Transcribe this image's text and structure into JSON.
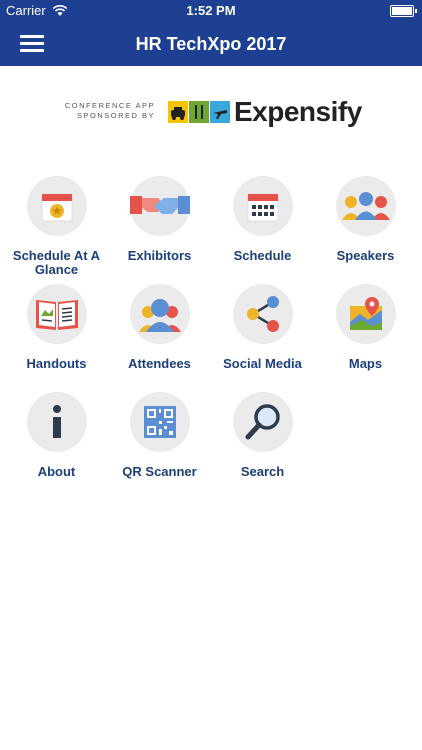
{
  "status_bar": {
    "carrier": "Carrier",
    "time": "1:52 PM",
    "battery_level": 1.0
  },
  "header": {
    "title": "HR TechXpo 2017",
    "menu_icon": "hamburger-menu-icon"
  },
  "sponsor": {
    "line1": "CONFERENCE APP",
    "line2": "SPONSORED BY",
    "brand": "Expensify"
  },
  "tiles": [
    {
      "label": "Schedule At A Glance",
      "icon": "calendar-star-icon"
    },
    {
      "label": "Exhibitors",
      "icon": "handshake-icon"
    },
    {
      "label": "Schedule",
      "icon": "calendar-grid-icon"
    },
    {
      "label": "Speakers",
      "icon": "people-group-icon"
    },
    {
      "label": "Handouts",
      "icon": "open-book-icon"
    },
    {
      "label": "Attendees",
      "icon": "attendees-icon"
    },
    {
      "label": "Social Media",
      "icon": "share-icon"
    },
    {
      "label": "Maps",
      "icon": "map-pin-icon"
    },
    {
      "label": "About",
      "icon": "info-icon"
    },
    {
      "label": "QR Scanner",
      "icon": "qr-code-icon"
    },
    {
      "label": "Search",
      "icon": "magnifier-icon"
    }
  ]
}
